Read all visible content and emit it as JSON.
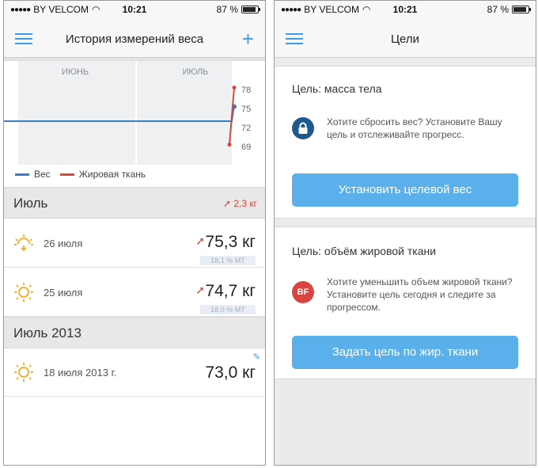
{
  "statusbar": {
    "carrier": "BY VELCOM",
    "time": "10:21",
    "battery": "87 %",
    "battery_level": 0.87
  },
  "left_screen": {
    "title": "История измерений веса",
    "chart_data": {
      "type": "line",
      "x_labels": [
        "ИЮНЬ",
        "ИЮЛЬ"
      ],
      "y_ticks": [
        78,
        75,
        72,
        69
      ],
      "ylim": [
        67,
        80
      ],
      "series": [
        {
          "name": "Вес",
          "color": "#3d7cc9",
          "values": [
            73.0,
            73.0,
            74.7,
            75.3
          ]
        },
        {
          "name": "Жировая ткань",
          "color": "#d9453f",
          "values": [
            null,
            null,
            69.3,
            78.3
          ]
        }
      ],
      "legend": "bottom-left"
    },
    "sections": [
      {
        "title": "Июль",
        "delta": "2,3 кг",
        "rows": [
          {
            "date": "26 июля",
            "weight": "75,3 кг",
            "fat": "18,1 % МТ"
          },
          {
            "date": "25 июля",
            "weight": "74,7 кг",
            "fat": "18,0 % МТ"
          }
        ]
      },
      {
        "title": "Июль 2013",
        "rows": [
          {
            "date": "18 июля 2013 г.",
            "weight": "73,0 кг"
          }
        ]
      }
    ]
  },
  "right_screen": {
    "title": "Цели",
    "goals": [
      {
        "title": "Цель: масса тела",
        "text": "Хотите сбросить вес? Установите Вашу цель и отслеживайте прогресс.",
        "button": "Установить целевой вес",
        "icon_color": "#1f5a8f"
      },
      {
        "title": "Цель: объём жировой ткани",
        "icon_label": "BF",
        "text": "Хотите уменьшить объем жировой ткани? Установите цель сегодня и следите за прогрессом.",
        "button": "Задать цель по жир. ткани",
        "icon_color": "#d9453f"
      }
    ]
  }
}
